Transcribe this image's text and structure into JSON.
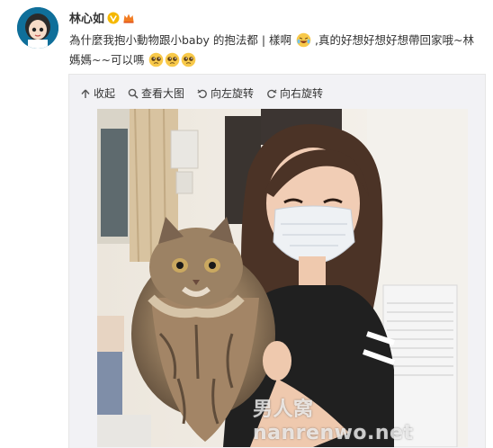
{
  "post": {
    "username": "林心如",
    "verified_icon": "verified-v-icon",
    "member_icon": "member-crown-icon",
    "text_part1": "為什麼我抱小動物跟小baby 的抱法都 | 樣啊",
    "text_part2": ",真的好想好想好想帶回家哦~林媽媽~~可以嗎"
  },
  "toolbar": {
    "collapse_label": "收起",
    "view_large_label": "查看大图",
    "rotate_left_label": "向左旋转",
    "rotate_right_label": "向右旋转"
  },
  "photo": {
    "watermark": "男人窝nanrenwo.net"
  },
  "colors": {
    "media_background": "#f2f2f5",
    "avatar_background": "#0f6f9a",
    "verified_badge": "#f5b800"
  }
}
